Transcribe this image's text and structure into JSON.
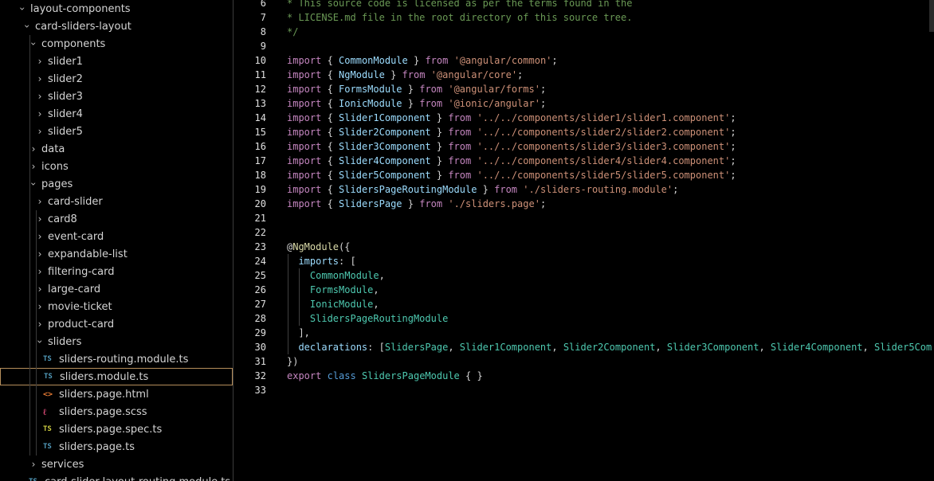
{
  "explorer": {
    "items": [
      {
        "label": "layout-components",
        "depth": 0,
        "kind": "folder",
        "open": true
      },
      {
        "label": "card-sliders-layout",
        "depth": 1,
        "kind": "folder",
        "open": true
      },
      {
        "label": "components",
        "depth": 2,
        "kind": "folder",
        "open": true
      },
      {
        "label": "slider1",
        "depth": 3,
        "kind": "folder",
        "open": false
      },
      {
        "label": "slider2",
        "depth": 3,
        "kind": "folder",
        "open": false
      },
      {
        "label": "slider3",
        "depth": 3,
        "kind": "folder",
        "open": false
      },
      {
        "label": "slider4",
        "depth": 3,
        "kind": "folder",
        "open": false
      },
      {
        "label": "slider5",
        "depth": 3,
        "kind": "folder",
        "open": false
      },
      {
        "label": "data",
        "depth": 2,
        "kind": "folder",
        "open": false
      },
      {
        "label": "icons",
        "depth": 2,
        "kind": "folder",
        "open": false
      },
      {
        "label": "pages",
        "depth": 2,
        "kind": "folder",
        "open": true
      },
      {
        "label": "card-slider",
        "depth": 3,
        "kind": "folder",
        "open": false
      },
      {
        "label": "card8",
        "depth": 3,
        "kind": "folder",
        "open": false
      },
      {
        "label": "event-card",
        "depth": 3,
        "kind": "folder",
        "open": false
      },
      {
        "label": "expandable-list",
        "depth": 3,
        "kind": "folder",
        "open": false
      },
      {
        "label": "filtering-card",
        "depth": 3,
        "kind": "folder",
        "open": false
      },
      {
        "label": "large-card",
        "depth": 3,
        "kind": "folder",
        "open": false
      },
      {
        "label": "movie-ticket",
        "depth": 3,
        "kind": "folder",
        "open": false
      },
      {
        "label": "product-card",
        "depth": 3,
        "kind": "folder",
        "open": false
      },
      {
        "label": "sliders",
        "depth": 3,
        "kind": "folder",
        "open": true
      },
      {
        "label": "sliders-routing.module.ts",
        "depth": 4,
        "kind": "ts",
        "icon_text": "TS"
      },
      {
        "label": "sliders.module.ts",
        "depth": 4,
        "kind": "ts",
        "icon_text": "TS",
        "selected": true
      },
      {
        "label": "sliders.page.html",
        "depth": 4,
        "kind": "html",
        "icon_text": "<>"
      },
      {
        "label": "sliders.page.scss",
        "depth": 4,
        "kind": "scss",
        "icon_text": "ℓ"
      },
      {
        "label": "sliders.page.spec.ts",
        "depth": 4,
        "kind": "tsspec",
        "icon_text": "TS"
      },
      {
        "label": "sliders.page.ts",
        "depth": 4,
        "kind": "ts",
        "icon_text": "TS"
      },
      {
        "label": "services",
        "depth": 2,
        "kind": "folder",
        "open": false
      },
      {
        "label": "card-slider-layout-routing.module.ts",
        "depth": 2,
        "kind": "ts",
        "icon_text": "TS"
      }
    ]
  },
  "editor": {
    "lines": [
      {
        "n": "6",
        "tokens": [
          {
            "t": "* This source code is licensed as per the terms found in the",
            "c": "comment"
          }
        ]
      },
      {
        "n": "7",
        "tokens": [
          {
            "t": "* LICENSE.md file in the root directory of this source tree.",
            "c": "comment"
          }
        ]
      },
      {
        "n": "8",
        "tokens": [
          {
            "t": "*/",
            "c": "comment"
          }
        ]
      },
      {
        "n": "9",
        "tokens": []
      },
      {
        "n": "10",
        "tokens": [
          {
            "t": "import",
            "c": "kw"
          },
          {
            "t": " { ",
            "c": "punc"
          },
          {
            "t": "CommonModule",
            "c": "type"
          },
          {
            "t": " } ",
            "c": "punc"
          },
          {
            "t": "from",
            "c": "kw"
          },
          {
            "t": " ",
            "c": "punc"
          },
          {
            "t": "'@angular/common'",
            "c": "str"
          },
          {
            "t": ";",
            "c": "punc"
          }
        ]
      },
      {
        "n": "11",
        "tokens": [
          {
            "t": "import",
            "c": "kw"
          },
          {
            "t": " { ",
            "c": "punc"
          },
          {
            "t": "NgModule",
            "c": "type"
          },
          {
            "t": " } ",
            "c": "punc"
          },
          {
            "t": "from",
            "c": "kw"
          },
          {
            "t": " ",
            "c": "punc"
          },
          {
            "t": "'@angular/core'",
            "c": "str"
          },
          {
            "t": ";",
            "c": "punc"
          }
        ]
      },
      {
        "n": "12",
        "tokens": [
          {
            "t": "import",
            "c": "kw"
          },
          {
            "t": " { ",
            "c": "punc"
          },
          {
            "t": "FormsModule",
            "c": "type"
          },
          {
            "t": " } ",
            "c": "punc"
          },
          {
            "t": "from",
            "c": "kw"
          },
          {
            "t": " ",
            "c": "punc"
          },
          {
            "t": "'@angular/forms'",
            "c": "str"
          },
          {
            "t": ";",
            "c": "punc"
          }
        ]
      },
      {
        "n": "13",
        "tokens": [
          {
            "t": "import",
            "c": "kw"
          },
          {
            "t": " { ",
            "c": "punc"
          },
          {
            "t": "IonicModule",
            "c": "type"
          },
          {
            "t": " } ",
            "c": "punc"
          },
          {
            "t": "from",
            "c": "kw"
          },
          {
            "t": " ",
            "c": "punc"
          },
          {
            "t": "'@ionic/angular'",
            "c": "str"
          },
          {
            "t": ";",
            "c": "punc"
          }
        ]
      },
      {
        "n": "14",
        "tokens": [
          {
            "t": "import",
            "c": "kw"
          },
          {
            "t": " { ",
            "c": "punc"
          },
          {
            "t": "Slider1Component",
            "c": "type"
          },
          {
            "t": " } ",
            "c": "punc"
          },
          {
            "t": "from",
            "c": "kw"
          },
          {
            "t": " ",
            "c": "punc"
          },
          {
            "t": "'../../components/slider1/slider1.component'",
            "c": "str"
          },
          {
            "t": ";",
            "c": "punc"
          }
        ]
      },
      {
        "n": "15",
        "tokens": [
          {
            "t": "import",
            "c": "kw"
          },
          {
            "t": " { ",
            "c": "punc"
          },
          {
            "t": "Slider2Component",
            "c": "type"
          },
          {
            "t": " } ",
            "c": "punc"
          },
          {
            "t": "from",
            "c": "kw"
          },
          {
            "t": " ",
            "c": "punc"
          },
          {
            "t": "'../../components/slider2/slider2.component'",
            "c": "str"
          },
          {
            "t": ";",
            "c": "punc"
          }
        ]
      },
      {
        "n": "16",
        "tokens": [
          {
            "t": "import",
            "c": "kw"
          },
          {
            "t": " { ",
            "c": "punc"
          },
          {
            "t": "Slider3Component",
            "c": "type"
          },
          {
            "t": " } ",
            "c": "punc"
          },
          {
            "t": "from",
            "c": "kw"
          },
          {
            "t": " ",
            "c": "punc"
          },
          {
            "t": "'../../components/slider3/slider3.component'",
            "c": "str"
          },
          {
            "t": ";",
            "c": "punc"
          }
        ]
      },
      {
        "n": "17",
        "tokens": [
          {
            "t": "import",
            "c": "kw"
          },
          {
            "t": " { ",
            "c": "punc"
          },
          {
            "t": "Slider4Component",
            "c": "type"
          },
          {
            "t": " } ",
            "c": "punc"
          },
          {
            "t": "from",
            "c": "kw"
          },
          {
            "t": " ",
            "c": "punc"
          },
          {
            "t": "'../../components/slider4/slider4.component'",
            "c": "str"
          },
          {
            "t": ";",
            "c": "punc"
          }
        ]
      },
      {
        "n": "18",
        "tokens": [
          {
            "t": "import",
            "c": "kw"
          },
          {
            "t": " { ",
            "c": "punc"
          },
          {
            "t": "Slider5Component",
            "c": "type"
          },
          {
            "t": " } ",
            "c": "punc"
          },
          {
            "t": "from",
            "c": "kw"
          },
          {
            "t": " ",
            "c": "punc"
          },
          {
            "t": "'../../components/slider5/slider5.component'",
            "c": "str"
          },
          {
            "t": ";",
            "c": "punc"
          }
        ]
      },
      {
        "n": "19",
        "tokens": [
          {
            "t": "import",
            "c": "kw"
          },
          {
            "t": " { ",
            "c": "punc"
          },
          {
            "t": "SlidersPageRoutingModule",
            "c": "type"
          },
          {
            "t": " } ",
            "c": "punc"
          },
          {
            "t": "from",
            "c": "kw"
          },
          {
            "t": " ",
            "c": "punc"
          },
          {
            "t": "'./sliders-routing.module'",
            "c": "str"
          },
          {
            "t": ";",
            "c": "punc"
          }
        ]
      },
      {
        "n": "20",
        "tokens": [
          {
            "t": "import",
            "c": "kw"
          },
          {
            "t": " { ",
            "c": "punc"
          },
          {
            "t": "SlidersPage",
            "c": "type"
          },
          {
            "t": " } ",
            "c": "punc"
          },
          {
            "t": "from",
            "c": "kw"
          },
          {
            "t": " ",
            "c": "punc"
          },
          {
            "t": "'./sliders.page'",
            "c": "str"
          },
          {
            "t": ";",
            "c": "punc"
          }
        ]
      },
      {
        "n": "21",
        "tokens": []
      },
      {
        "n": "22",
        "tokens": []
      },
      {
        "n": "23",
        "tokens": [
          {
            "t": "@",
            "c": "punc"
          },
          {
            "t": "NgModule",
            "c": "deco"
          },
          {
            "t": "({",
            "c": "punc"
          }
        ]
      },
      {
        "n": "24",
        "tokens": [
          {
            "t": "  ",
            "c": "punc"
          },
          {
            "t": "imports",
            "c": "prop"
          },
          {
            "t": ": [",
            "c": "punc"
          }
        ]
      },
      {
        "n": "25",
        "tokens": [
          {
            "t": "    ",
            "c": "punc"
          },
          {
            "t": "CommonModule",
            "c": "ident"
          },
          {
            "t": ",",
            "c": "punc"
          }
        ]
      },
      {
        "n": "26",
        "tokens": [
          {
            "t": "    ",
            "c": "punc"
          },
          {
            "t": "FormsModule",
            "c": "ident"
          },
          {
            "t": ",",
            "c": "punc"
          }
        ]
      },
      {
        "n": "27",
        "tokens": [
          {
            "t": "    ",
            "c": "punc"
          },
          {
            "t": "IonicModule",
            "c": "ident"
          },
          {
            "t": ",",
            "c": "punc"
          }
        ]
      },
      {
        "n": "28",
        "tokens": [
          {
            "t": "    ",
            "c": "punc"
          },
          {
            "t": "SlidersPageRoutingModule",
            "c": "ident"
          }
        ]
      },
      {
        "n": "29",
        "tokens": [
          {
            "t": "  ],",
            "c": "punc"
          }
        ]
      },
      {
        "n": "30",
        "tokens": [
          {
            "t": "  ",
            "c": "punc"
          },
          {
            "t": "declarations",
            "c": "prop"
          },
          {
            "t": ": [",
            "c": "punc"
          },
          {
            "t": "SlidersPage",
            "c": "ident"
          },
          {
            "t": ", ",
            "c": "punc"
          },
          {
            "t": "Slider1Component",
            "c": "ident"
          },
          {
            "t": ", ",
            "c": "punc"
          },
          {
            "t": "Slider2Component",
            "c": "ident"
          },
          {
            "t": ", ",
            "c": "punc"
          },
          {
            "t": "Slider3Component",
            "c": "ident"
          },
          {
            "t": ", ",
            "c": "punc"
          },
          {
            "t": "Slider4Component",
            "c": "ident"
          },
          {
            "t": ", ",
            "c": "punc"
          },
          {
            "t": "Slider5Com",
            "c": "ident"
          }
        ]
      },
      {
        "n": "31",
        "tokens": [
          {
            "t": "})",
            "c": "punc"
          }
        ]
      },
      {
        "n": "32",
        "tokens": [
          {
            "t": "export",
            "c": "kw"
          },
          {
            "t": " ",
            "c": "punc"
          },
          {
            "t": "class",
            "c": "storage"
          },
          {
            "t": " ",
            "c": "punc"
          },
          {
            "t": "SlidersPageModule",
            "c": "cls"
          },
          {
            "t": " { }",
            "c": "punc"
          }
        ]
      },
      {
        "n": "33",
        "tokens": []
      }
    ]
  },
  "colors": {
    "background": "#000000",
    "selection_border": "#b58e5b",
    "keyword": "#c586c0",
    "string": "#ce9178",
    "comment": "#6a9955",
    "type": "#9cdcfe",
    "identifier": "#4ec9b0"
  }
}
